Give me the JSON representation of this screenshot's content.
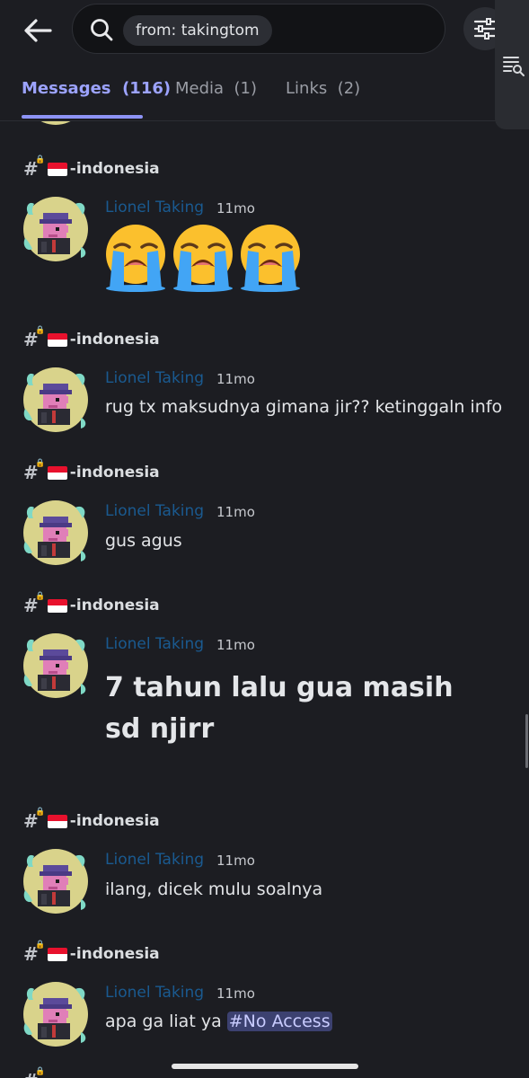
{
  "search": {
    "query": "from: takingtom"
  },
  "tabs": [
    {
      "label": "Messages",
      "count": "(116)"
    },
    {
      "label": "Media",
      "count": "(1)"
    },
    {
      "label": "Links",
      "count": "(2)"
    }
  ],
  "messages": [
    {
      "channel": "-indonesia",
      "author": "Lionel Taking",
      "time": "11mo",
      "text": ""
    },
    {
      "channel": "-indonesia",
      "author": "Lionel Taking",
      "time": "11mo",
      "text": "rug tx maksudnya gimana jir?? ketinggaln info"
    },
    {
      "channel": "-indonesia",
      "author": "Lionel Taking",
      "time": "11mo",
      "text": "gus agus"
    },
    {
      "channel": "-indonesia",
      "author": "Lionel Taking",
      "time": "11mo",
      "text": "7 tahun lalu gua masih sd njirr"
    },
    {
      "channel": "-indonesia",
      "author": "Lionel Taking",
      "time": "11mo",
      "text": "ilang, dicek mulu soalnya"
    },
    {
      "channel": "-indonesia",
      "author": "Lionel Taking",
      "time": "11mo",
      "text": "apa ga liat ya",
      "mention": "#No Access"
    }
  ],
  "colors": {
    "accent": "#8d93f6",
    "author": "#1a5a90",
    "background": "#1c1d22"
  },
  "icons": [
    "back-arrow-icon",
    "search-icon",
    "filter-icon",
    "search-list-icon",
    "loudly-crying-face-emoji"
  ]
}
